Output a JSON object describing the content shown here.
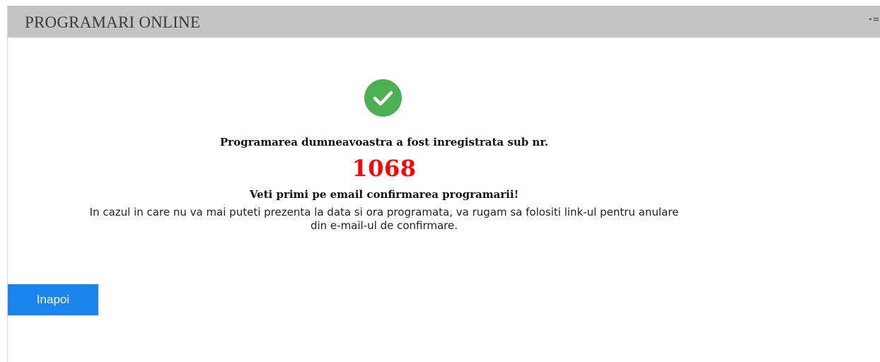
{
  "header": {
    "title": "PROGRAMARI ONLINE",
    "menu_icon": "dropdown-menu-icon"
  },
  "confirmation": {
    "icon": "check-circle-icon",
    "icon_color": "#4caf50",
    "registered_text": "Programarea dumneavoastra a fost inregistrata sub nr.",
    "appointment_number": "1068",
    "number_color": "#ff0000",
    "email_text": "Veti primi pe email confirmarea programarii!",
    "cancel_line1": "In cazul in care nu va mai puteti prezenta la data si ora programata, va rugam sa folositi link-ul pentru anulare",
    "cancel_line2": "din e-mail-ul de confirmare."
  },
  "actions": {
    "back_label": "Inapoi",
    "back_color": "#1a85ee"
  }
}
